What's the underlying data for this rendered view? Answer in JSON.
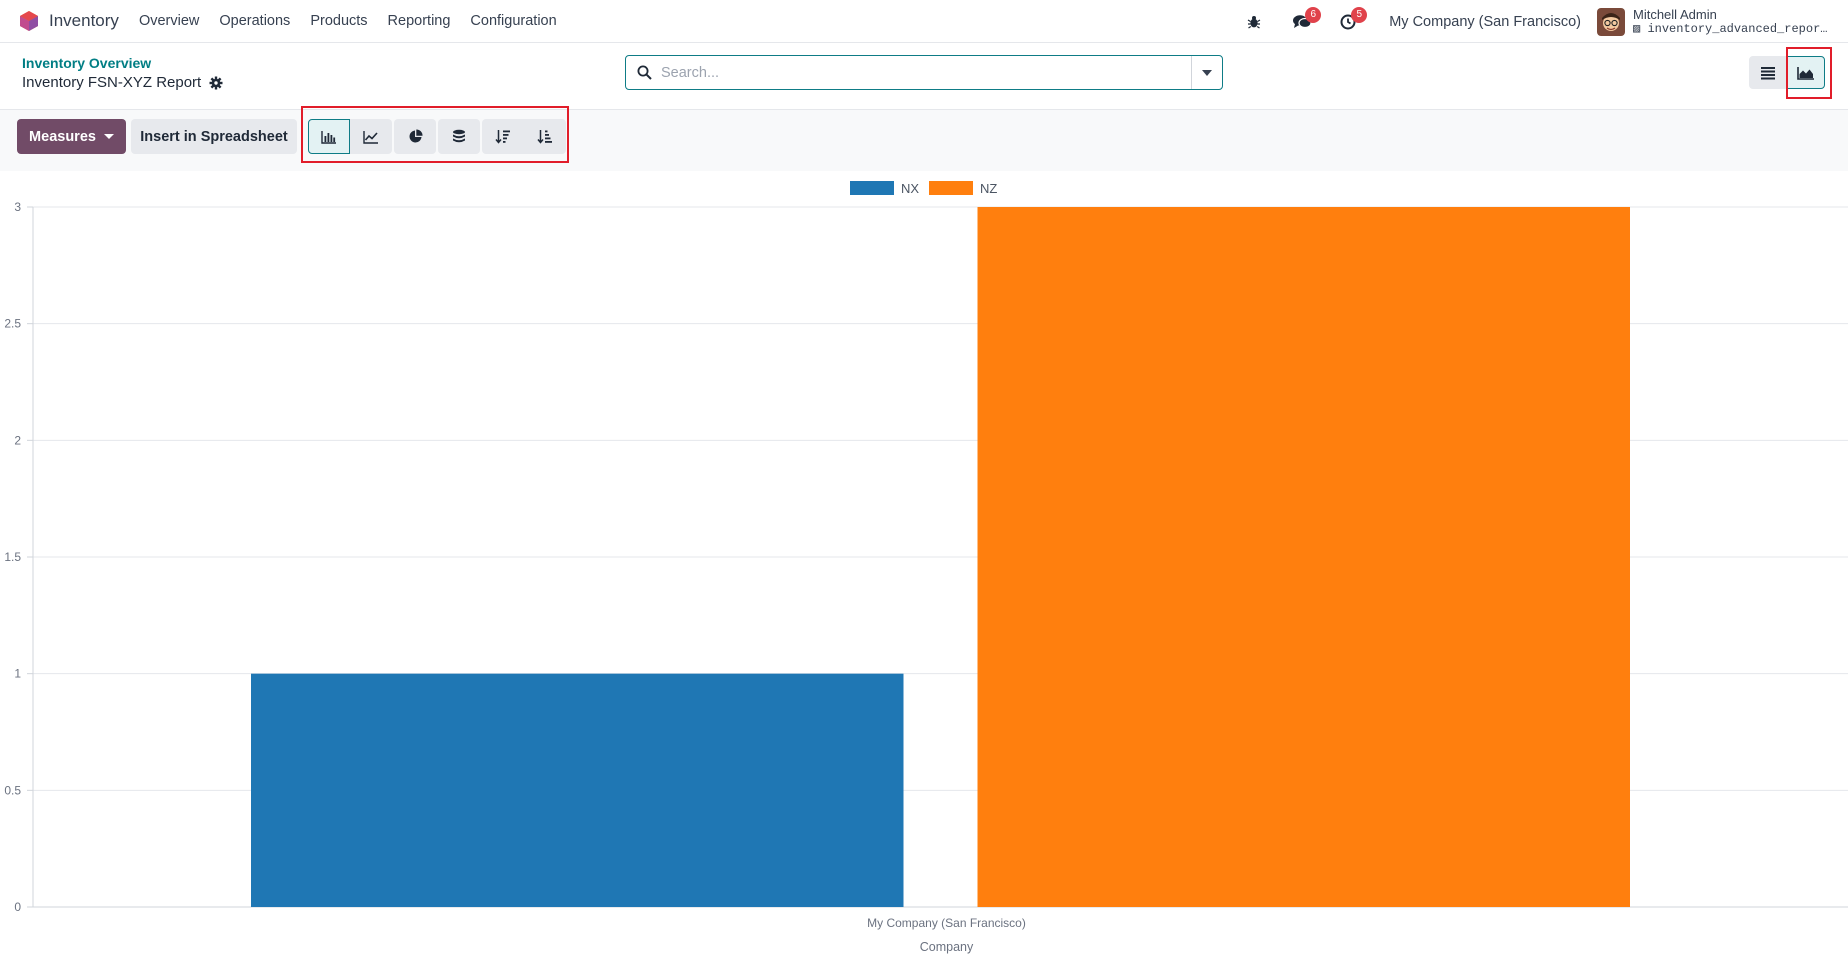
{
  "navbar": {
    "app_name": "Inventory",
    "menu": [
      "Overview",
      "Operations",
      "Products",
      "Reporting",
      "Configuration"
    ],
    "messages_count": "6",
    "activities_count": "5",
    "company": "My Company (San Francisco)",
    "user_name": "Mitchell Admin",
    "database": "inventory_advanced_repor…",
    "icons": [
      "debug-bug-icon",
      "chat-icon",
      "clock-icon"
    ]
  },
  "breadcrumb": {
    "parent": "Inventory Overview",
    "current": "Inventory FSN-XYZ Report"
  },
  "search": {
    "placeholder": "Search..."
  },
  "toolbar": {
    "measures_label": "Measures",
    "spreadsheet_label": "Insert in Spreadsheet",
    "chart_tools": [
      "bar-chart-icon",
      "line-chart-icon",
      "pie-chart-icon",
      "stacked-icon",
      "sort-descending-icon",
      "sort-ascending-icon"
    ],
    "active_chart_tool": "bar-chart-icon"
  },
  "view_switcher": {
    "views": [
      "list-view-icon",
      "graph-view-icon"
    ],
    "active_view": "graph-view-icon"
  },
  "colors": {
    "brand": "#714b67",
    "accent": "#017e84",
    "badge": "#e0424b",
    "series_nx": "#1f77b4",
    "series_nz": "#ff7f0e"
  },
  "chart_data": {
    "type": "bar",
    "categories": [
      "My Company (San Francisco)"
    ],
    "series": [
      {
        "name": "NX",
        "values": [
          1
        ],
        "color": "#1f77b4"
      },
      {
        "name": "NZ",
        "values": [
          3
        ],
        "color": "#ff7f0e"
      }
    ],
    "xlabel": "Company",
    "ylabel": "",
    "ylim": [
      0,
      3
    ],
    "yticks": [
      "0",
      "0.5",
      "1",
      "1.5",
      "2",
      "2.5",
      "3"
    ],
    "grid": true,
    "legend": "top-center"
  }
}
